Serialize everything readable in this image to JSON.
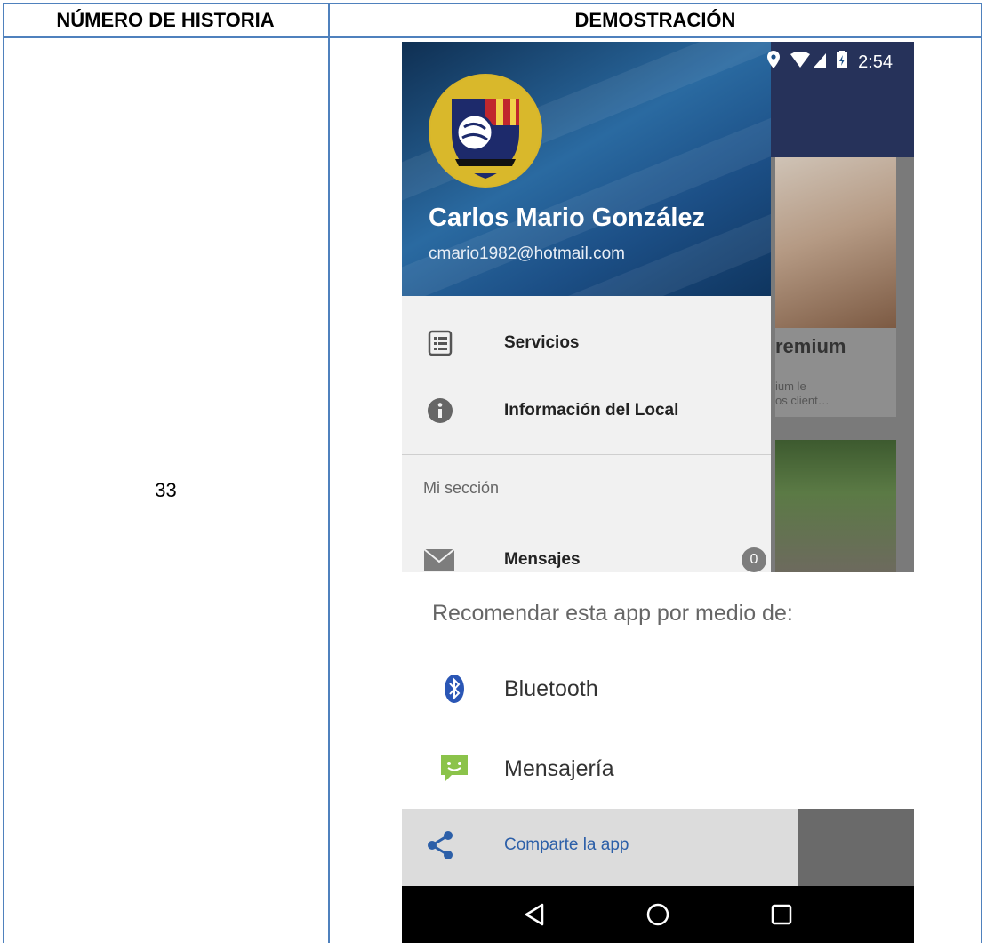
{
  "table": {
    "headers": [
      "NÚMERO DE HISTORIA",
      "DEMOSTRACIÓN"
    ],
    "story_number": "33"
  },
  "phone": {
    "status_bar": {
      "icons": [
        "location-icon",
        "wifi-icon",
        "signal-icon",
        "battery-icon"
      ],
      "time": "2:54"
    },
    "background": {
      "card_title": "remium",
      "card_text": "ium le\nos client…"
    },
    "drawer": {
      "user_name": "Carlos Mario González",
      "user_email": "cmario1982@hotmail.com",
      "items": [
        {
          "label": "Servicios",
          "icon": "list-icon"
        },
        {
          "label": "Información del Local",
          "icon": "info-icon"
        }
      ],
      "section_title": "Mi sección",
      "messages": {
        "label": "Mensajes",
        "badge": "0",
        "icon": "mail-icon"
      },
      "footer": {
        "label": "Comparte la app",
        "icon": "share-icon"
      }
    },
    "share_sheet": {
      "title": "Recomendar esta app por medio de:",
      "options": [
        {
          "label": "Bluetooth",
          "icon": "bluetooth-icon"
        },
        {
          "label": "Mensajería",
          "icon": "messaging-icon"
        }
      ]
    },
    "nav_bar": [
      "back-icon",
      "home-icon",
      "recents-icon"
    ]
  },
  "colors": {
    "table_border": "#4f81bd",
    "drawer_header": "#1c4f86",
    "link_blue": "#2c5fa8"
  }
}
